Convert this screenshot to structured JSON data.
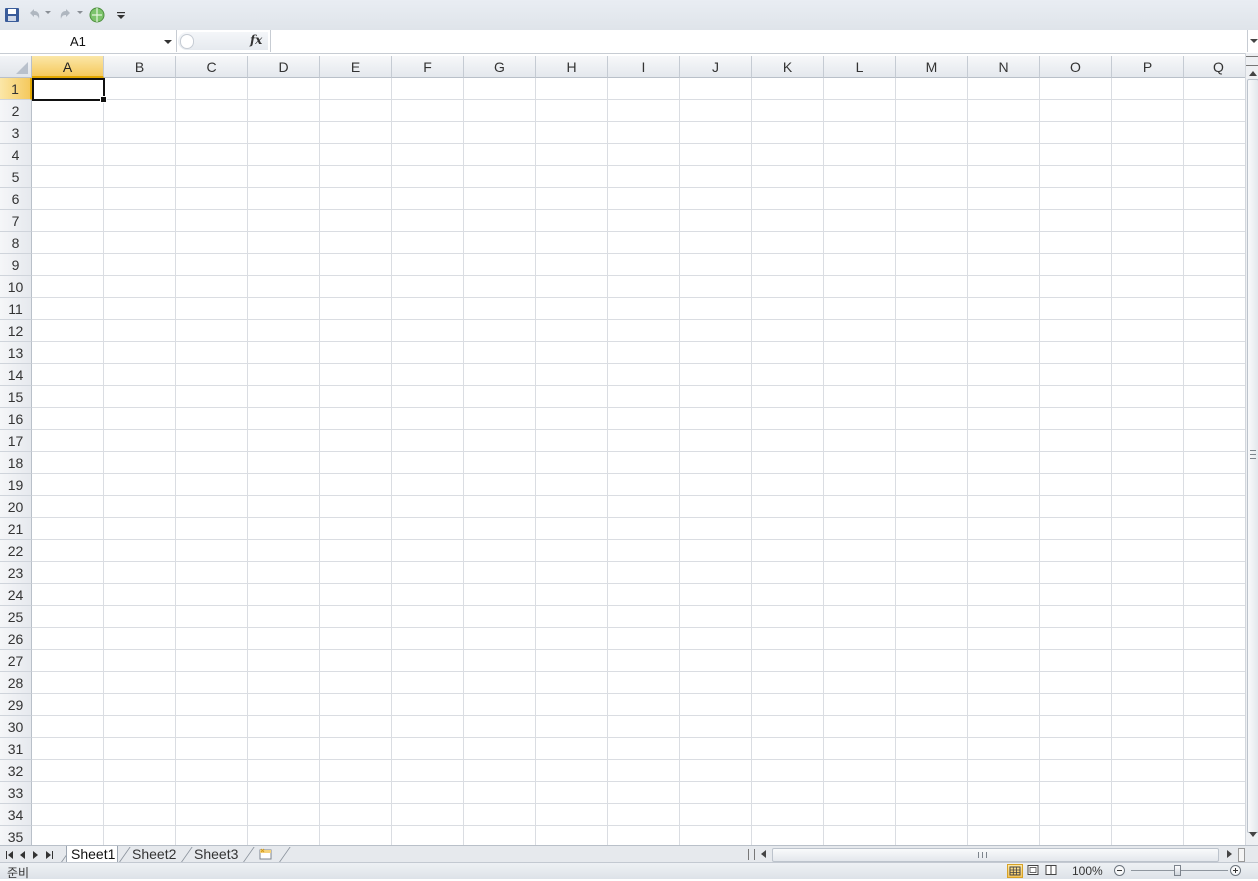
{
  "toolbar": {
    "icons": [
      "save-icon",
      "undo-icon",
      "redo-icon",
      "browser-icon",
      "customize-icon"
    ]
  },
  "formula_bar": {
    "name_box": "A1",
    "fx_label": "fx",
    "formula_value": ""
  },
  "grid": {
    "columns": [
      "A",
      "B",
      "C",
      "D",
      "E",
      "F",
      "G",
      "H",
      "I",
      "J",
      "K",
      "L",
      "M",
      "N",
      "O",
      "P",
      "Q"
    ],
    "rows": [
      "1",
      "2",
      "3",
      "4",
      "5",
      "6",
      "7",
      "8",
      "9",
      "10",
      "11",
      "12",
      "13",
      "14",
      "15",
      "16",
      "17",
      "18",
      "19",
      "20",
      "21",
      "22",
      "23",
      "24",
      "25",
      "26",
      "27",
      "28",
      "29",
      "30",
      "31",
      "32",
      "33",
      "34",
      "35"
    ],
    "selected_column": "A",
    "selected_row": "1"
  },
  "sheet_tabs": {
    "tabs": [
      "Sheet1",
      "Sheet2",
      "Sheet3"
    ],
    "active": "Sheet1"
  },
  "status_bar": {
    "status": "준비",
    "zoom": "100%",
    "view_mode": "normal"
  }
}
